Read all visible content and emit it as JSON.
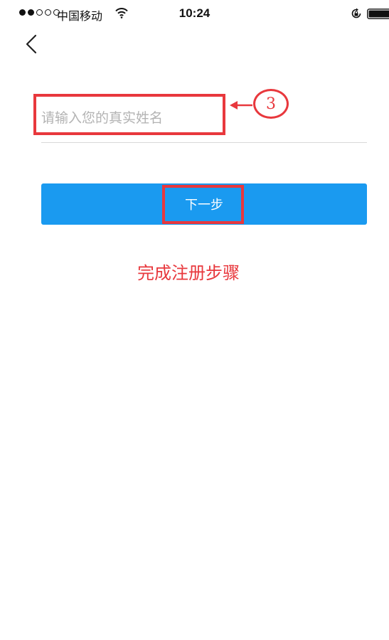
{
  "status_bar": {
    "carrier": "中国移动",
    "time": "10:24",
    "signal_filled": 2,
    "signal_total": 5
  },
  "form": {
    "name_placeholder": "请输入您的真实姓名",
    "name_value": "",
    "next_label": "下一步"
  },
  "annotation": {
    "step_number": "3",
    "caption": "完成注册步骤",
    "color": "#e8383d"
  },
  "colors": {
    "primary": "#1a9af0",
    "text": "#111111",
    "placeholder": "#b3b3b3"
  },
  "icons": {
    "back": "chevron-left-icon",
    "wifi": "wifi-icon",
    "orientation_lock": "lock-rotation-icon",
    "battery": "battery-icon"
  }
}
